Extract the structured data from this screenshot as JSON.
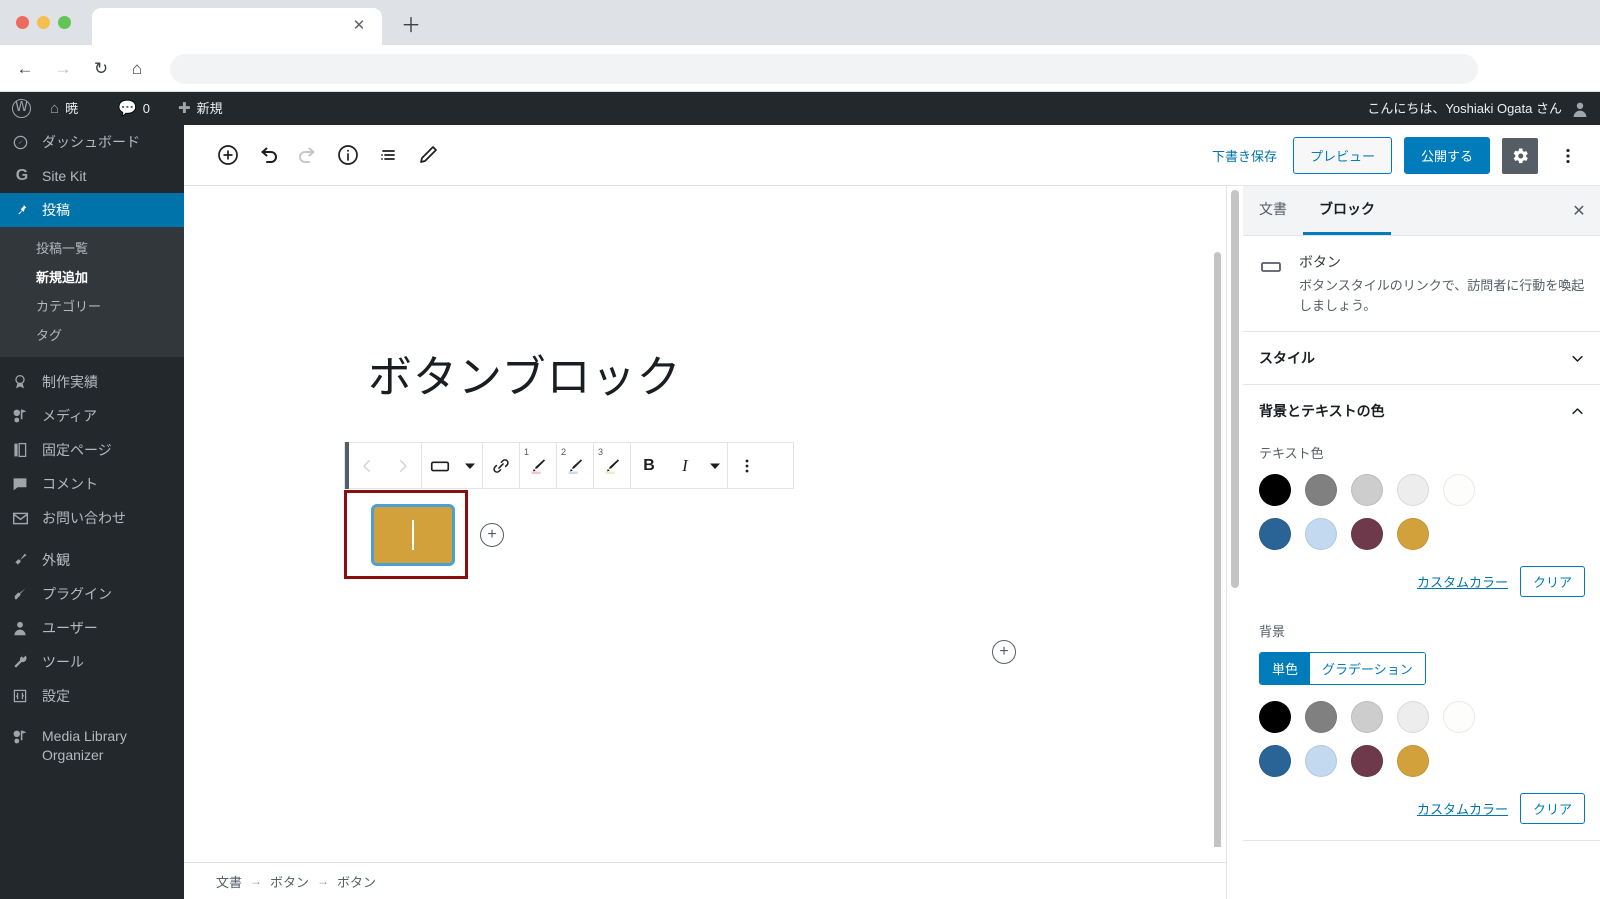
{
  "browser": {
    "tab_title": "",
    "url": "",
    "close_icon": "close-icon",
    "new_tab_icon": "plus-icon",
    "back_icon": "arrow-left-icon",
    "forward_icon": "arrow-right-icon",
    "reload_icon": "reload-icon",
    "home_icon": "home-icon",
    "menu_icon": "kebab-menu-icon"
  },
  "adminbar": {
    "logo": "wordpress-logo-icon",
    "site_name": "暁",
    "comments_count": "0",
    "new_label": "新規",
    "greeting": "こんにちは、Yoshiaki Ogata さん"
  },
  "sidebar": {
    "items": [
      {
        "label": "ダッシュボード",
        "icon": "dashboard-icon",
        "current": false
      },
      {
        "label": "Site Kit",
        "icon": "site-kit-icon",
        "current": false
      },
      {
        "label": "投稿",
        "icon": "pin-icon",
        "current": true
      }
    ],
    "submenu": [
      {
        "label": "投稿一覧",
        "current": false
      },
      {
        "label": "新規追加",
        "current": true
      },
      {
        "label": "カテゴリー",
        "current": false
      },
      {
        "label": "タグ",
        "current": false
      }
    ],
    "items2": [
      {
        "label": "制作実績",
        "icon": "award-icon"
      },
      {
        "label": "メディア",
        "icon": "media-icon"
      },
      {
        "label": "固定ページ",
        "icon": "pages-icon"
      },
      {
        "label": "コメント",
        "icon": "comment-icon"
      },
      {
        "label": "お問い合わせ",
        "icon": "mail-icon"
      }
    ],
    "items3": [
      {
        "label": "外観",
        "icon": "appearance-icon"
      },
      {
        "label": "プラグイン",
        "icon": "plugin-icon"
      },
      {
        "label": "ユーザー",
        "icon": "user-icon"
      },
      {
        "label": "ツール",
        "icon": "tools-icon"
      },
      {
        "label": "設定",
        "icon": "settings-icon"
      }
    ],
    "items4": [
      {
        "label": "Media Library Organizer",
        "icon": "media-icon"
      }
    ]
  },
  "editor_header": {
    "add_block_icon": "plus-circle-icon",
    "undo_icon": "undo-icon",
    "redo_icon": "redo-icon",
    "info_icon": "info-circle-icon",
    "list_view_icon": "list-view-icon",
    "edit_icon": "pencil-icon",
    "save_draft_label": "下書き保存",
    "preview_label": "プレビュー",
    "publish_label": "公開する",
    "settings_gear_icon": "gear-icon",
    "more_menu_icon": "kebab-menu-icon"
  },
  "content": {
    "post_title": "ボタンブロック",
    "block_appender_icon": "plus-circle-icon",
    "button_block": {
      "background_color": "#d2a13c",
      "selection_color": "#8b0e0e",
      "focus_border_color": "#4a9fd4",
      "text": ""
    }
  },
  "block_toolbar": {
    "prev_icon": "chevron-left-icon",
    "next_icon": "chevron-right-icon",
    "block_type_icon": "button-block-icon",
    "block_type_dropdown_icon": "chevron-down-icon",
    "link_icon": "link-icon",
    "markers": [
      {
        "number": "1",
        "icon": "marker-pen-icon",
        "color": "#f0c4c4"
      },
      {
        "number": "2",
        "icon": "marker-pen-icon",
        "color": "#c3dcf0"
      },
      {
        "number": "3",
        "icon": "marker-pen-icon",
        "color": "#f5eab8"
      }
    ],
    "bold_label": "B",
    "italic_label": "I",
    "more_formats_icon": "chevron-down-icon",
    "options_icon": "kebab-menu-icon"
  },
  "breadcrumb": {
    "items": [
      "文書",
      "ボタン",
      "ボタン"
    ],
    "separator": "→"
  },
  "settings": {
    "tabs": [
      {
        "label": "文書",
        "active": false
      },
      {
        "label": "ブロック",
        "active": true
      }
    ],
    "close_icon": "close-icon",
    "block_card": {
      "icon": "button-block-icon",
      "title": "ボタン",
      "description": "ボタンスタイルのリンクで、訪問者に行動を喚起しましょう。"
    },
    "panels": [
      {
        "title": "スタイル",
        "expanded": false,
        "chevron": "chevron-down-icon"
      },
      {
        "title": "背景とテキストの色",
        "expanded": true,
        "chevron": "chevron-up-icon"
      }
    ],
    "text_color": {
      "label": "テキスト色",
      "swatches": [
        "#000000",
        "#808080",
        "#cdcdcd",
        "#ededed",
        "#fdfdfb",
        "#2a6496",
        "#c3d9f0",
        "#6e3a4b",
        "#d2a13c"
      ],
      "custom_color_label": "カスタムカラー",
      "clear_label": "クリア"
    },
    "background": {
      "label": "背景",
      "solid_label": "単色",
      "gradient_label": "グラデーション",
      "active_tab": "単色",
      "swatches": [
        "#000000",
        "#808080",
        "#cdcdcd",
        "#ededed",
        "#fdfdfb",
        "#2a6496",
        "#c3d9f0",
        "#6e3a4b",
        "#d2a13c"
      ],
      "custom_color_label": "カスタムカラー",
      "clear_label": "クリア"
    }
  }
}
